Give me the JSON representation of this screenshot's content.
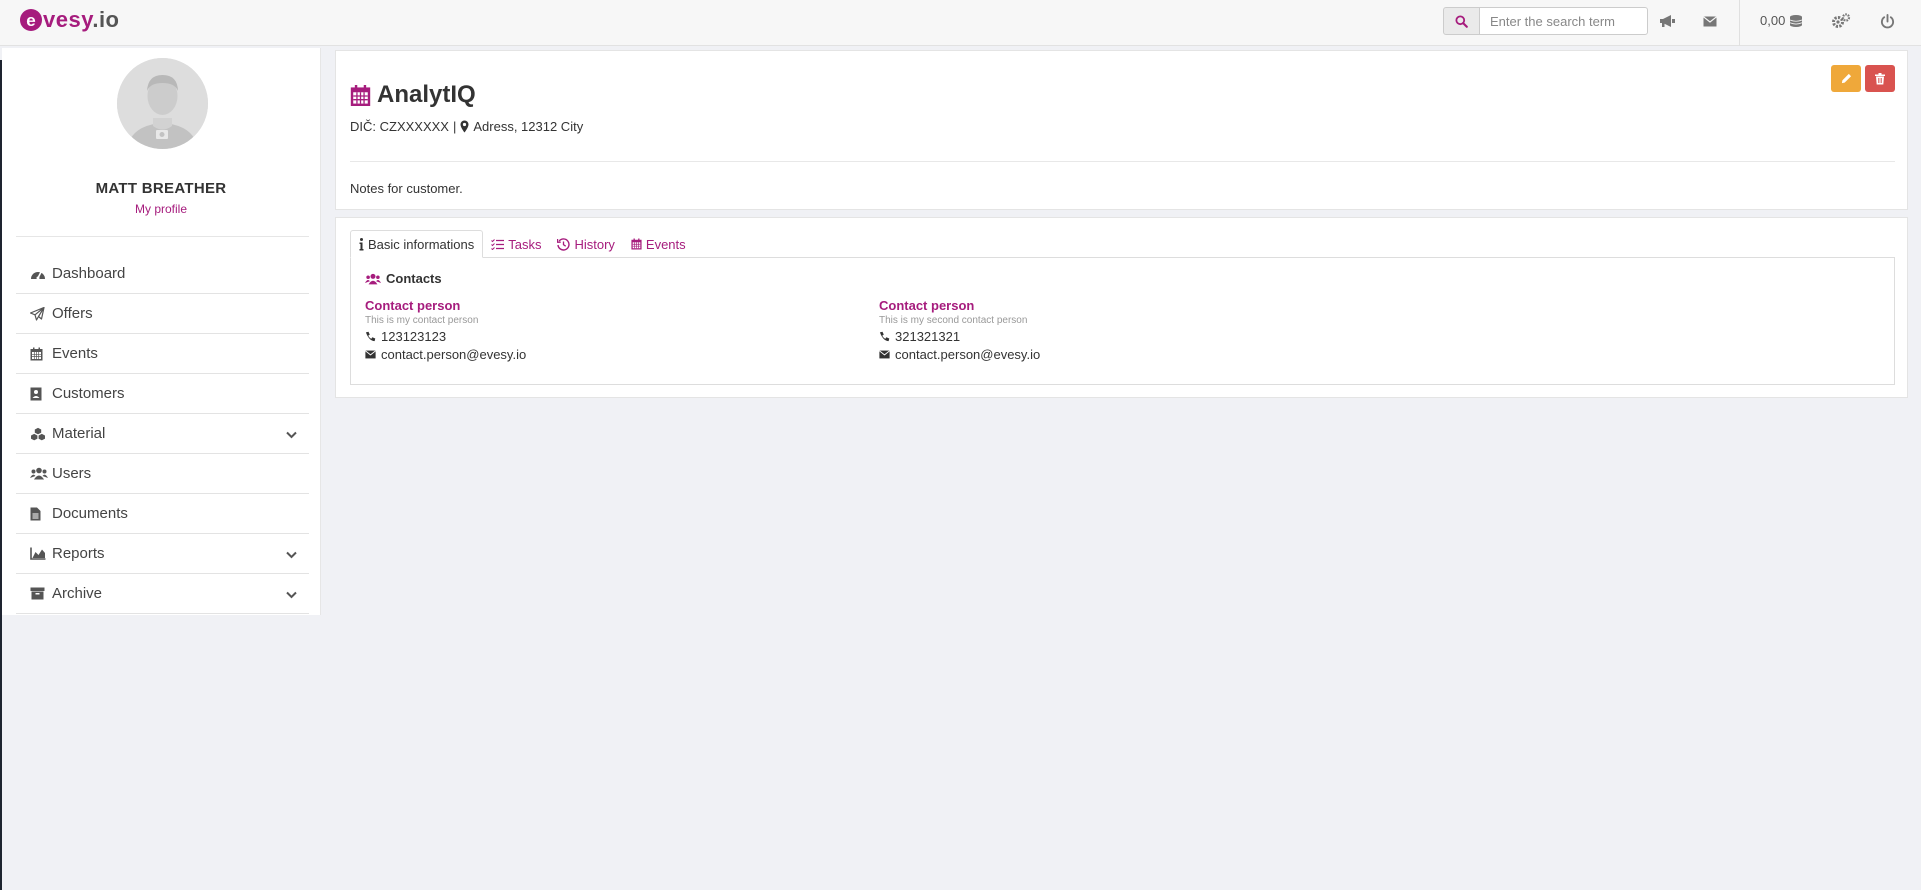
{
  "brand": {
    "logo_letter": "e",
    "logo_text": "vesy",
    "logo_dot": ".",
    "logo_tld": "io",
    "accent_color": "#a61c7d"
  },
  "topbar": {
    "search_placeholder": "Enter the search term",
    "credit_value": "0,00",
    "icons": [
      "search-icon",
      "megaphone-icon",
      "envelope-icon",
      "coins-icon",
      "gears-icon",
      "power-icon"
    ]
  },
  "sidebar": {
    "user_name": "MATT BREATHER",
    "profile_link": "My profile",
    "items": [
      {
        "label": "Dashboard",
        "icon": "tachometer-icon",
        "has_children": false
      },
      {
        "label": "Offers",
        "icon": "paper-plane-icon",
        "has_children": false
      },
      {
        "label": "Events",
        "icon": "calendar-icon",
        "has_children": false
      },
      {
        "label": "Customers",
        "icon": "id-card-icon",
        "has_children": false
      },
      {
        "label": "Material",
        "icon": "cubes-icon",
        "has_children": true
      },
      {
        "label": "Users",
        "icon": "users-icon",
        "has_children": false
      },
      {
        "label": "Documents",
        "icon": "file-icon",
        "has_children": false
      },
      {
        "label": "Reports",
        "icon": "chart-area-icon",
        "has_children": true
      },
      {
        "label": "Archive",
        "icon": "archive-icon",
        "has_children": true
      }
    ]
  },
  "customer": {
    "name": "AnalytIQ",
    "vat_label": "DIČ: CZXXXXXX",
    "separator": "|",
    "address": "Adress, 12312 City",
    "notes": "Notes for customer.",
    "edit_color": "#efa83a",
    "delete_color": "#d9534f"
  },
  "tabs": [
    {
      "label": "Basic informations",
      "icon": "info-icon",
      "active": true
    },
    {
      "label": "Tasks",
      "icon": "list-icon",
      "active": false
    },
    {
      "label": "History",
      "icon": "history-icon",
      "active": false
    },
    {
      "label": "Events",
      "icon": "calendar-icon",
      "active": false
    }
  ],
  "contacts": {
    "heading": "Contacts",
    "items": [
      {
        "name": "Contact person",
        "description": "This is my contact person",
        "phone": "123123123",
        "email": "contact.person@evesy.io"
      },
      {
        "name": "Contact person",
        "description": "This is my second contact person",
        "phone": "321321321",
        "email": "contact.person@evesy.io"
      }
    ]
  }
}
